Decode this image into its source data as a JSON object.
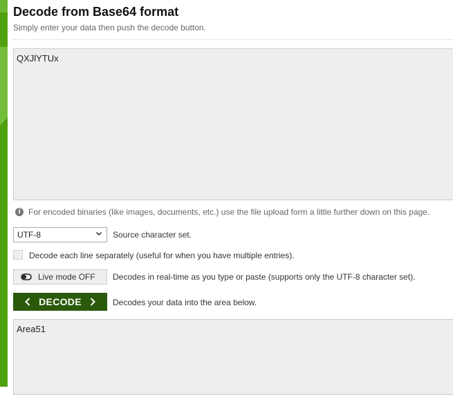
{
  "header": {
    "title": "Decode from Base64 format",
    "subtitle": "Simply enter your data then push the decode button."
  },
  "input": {
    "value": "QXJlYTUx"
  },
  "info": {
    "icon": "info-icon",
    "text": "For encoded binaries (like images, documents, etc.) use the file upload form a little further down on this page."
  },
  "charset": {
    "selected": "UTF-8",
    "label": "Source character set."
  },
  "line_option": {
    "checked": false,
    "label": "Decode each line separately (useful for when you have multiple entries)."
  },
  "live_mode": {
    "button_label": "Live mode OFF",
    "description": "Decodes in real-time as you type or paste (supports only the UTF-8 character set)."
  },
  "decode": {
    "button_label": "DECODE",
    "description": "Decodes your data into the area below."
  },
  "output": {
    "value": "Area51"
  },
  "colors": {
    "accent": "#4fa00e",
    "decode_button": "#2a5a0a",
    "field_background": "#eeeeee"
  }
}
